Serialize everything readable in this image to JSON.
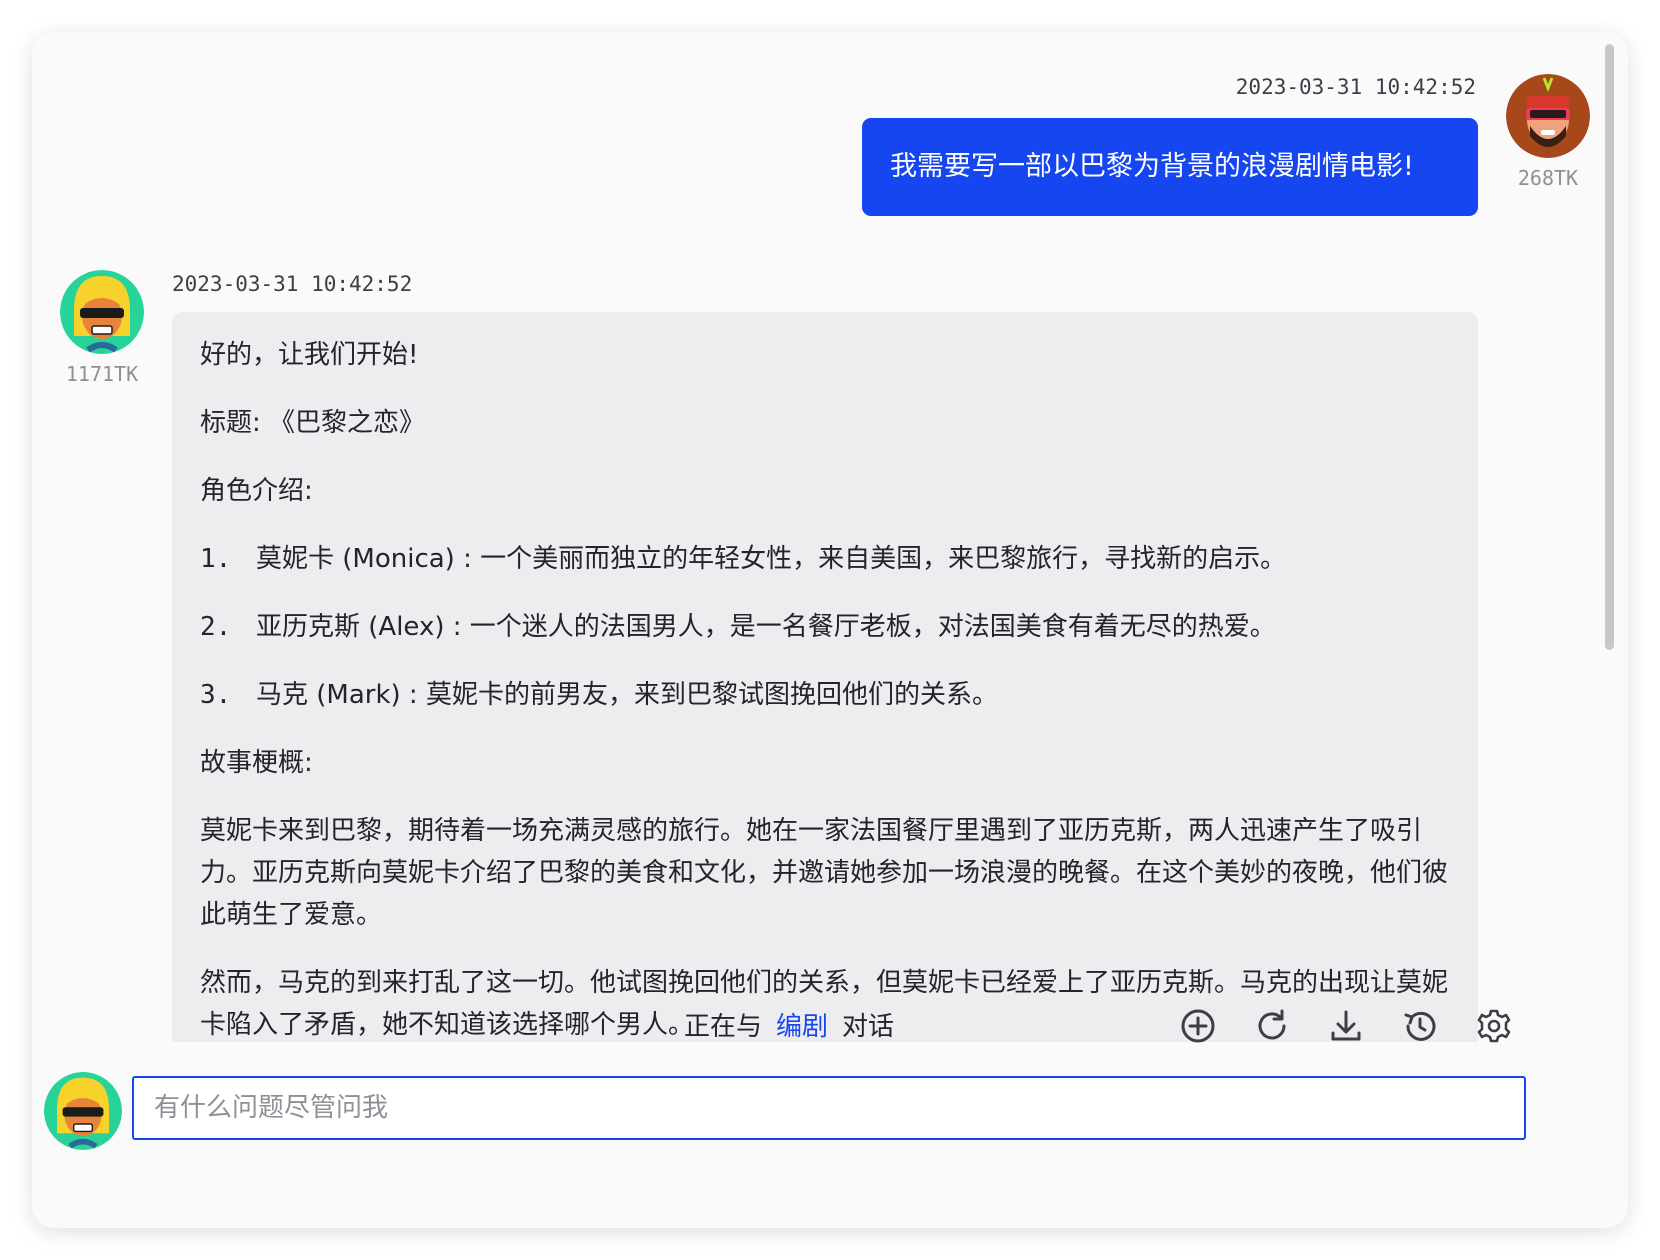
{
  "user_message": {
    "timestamp": "2023-03-31 10:42:52",
    "text": "我需要写一部以巴黎为背景的浪漫剧情电影!",
    "tokens": "268TK"
  },
  "bot_message": {
    "timestamp": "2023-03-31 10:42:52",
    "tokens": "1171TK",
    "greeting": "好的，让我们开始!",
    "title_line": "标题: 《巴黎之恋》",
    "roles_heading": "角色介绍:",
    "roles": [
      {
        "num": "1.",
        "text": "莫妮卡 (Monica) : 一个美丽而独立的年轻女性，来自美国，来巴黎旅行，寻找新的启示。"
      },
      {
        "num": "2.",
        "text": "亚历克斯 (Alex) : 一个迷人的法国男人，是一名餐厅老板，对法国美食有着无尽的热爱。"
      },
      {
        "num": "3.",
        "text": "马克 (Mark) : 莫妮卡的前男友，来到巴黎试图挽回他们的关系。"
      }
    ],
    "story_heading": "故事梗概:",
    "story_p1": "莫妮卡来到巴黎，期待着一场充满灵感的旅行。她在一家法国餐厅里遇到了亚历克斯，两人迅速产生了吸引力。亚历克斯向莫妮卡介绍了巴黎的美食和文化，并邀请她参加一场浪漫的晚餐。在这个美妙的夜晚，他们彼此萌生了爱意。",
    "story_p2": "然而，马克的到来打乱了这一切。他试图挽回他们的关系，但莫妮卡已经爱上了亚历克斯。马克的出现让莫妮卡陷入了矛盾，她不知道该选择哪个男人。"
  },
  "status": {
    "prefix": "正在与",
    "role": "编剧",
    "suffix": "对话"
  },
  "toolbar": {
    "icons": [
      "add-circle-icon",
      "refresh-icon",
      "download-icon",
      "history-icon",
      "settings-icon"
    ]
  },
  "input": {
    "placeholder": "有什么问题尽管问我",
    "value": ""
  },
  "colors": {
    "accent": "#1546f0",
    "bot_bubble": "#ededf0",
    "bot_avatar_bg": "#28d39a",
    "user_avatar_bg": "#a6481a"
  }
}
